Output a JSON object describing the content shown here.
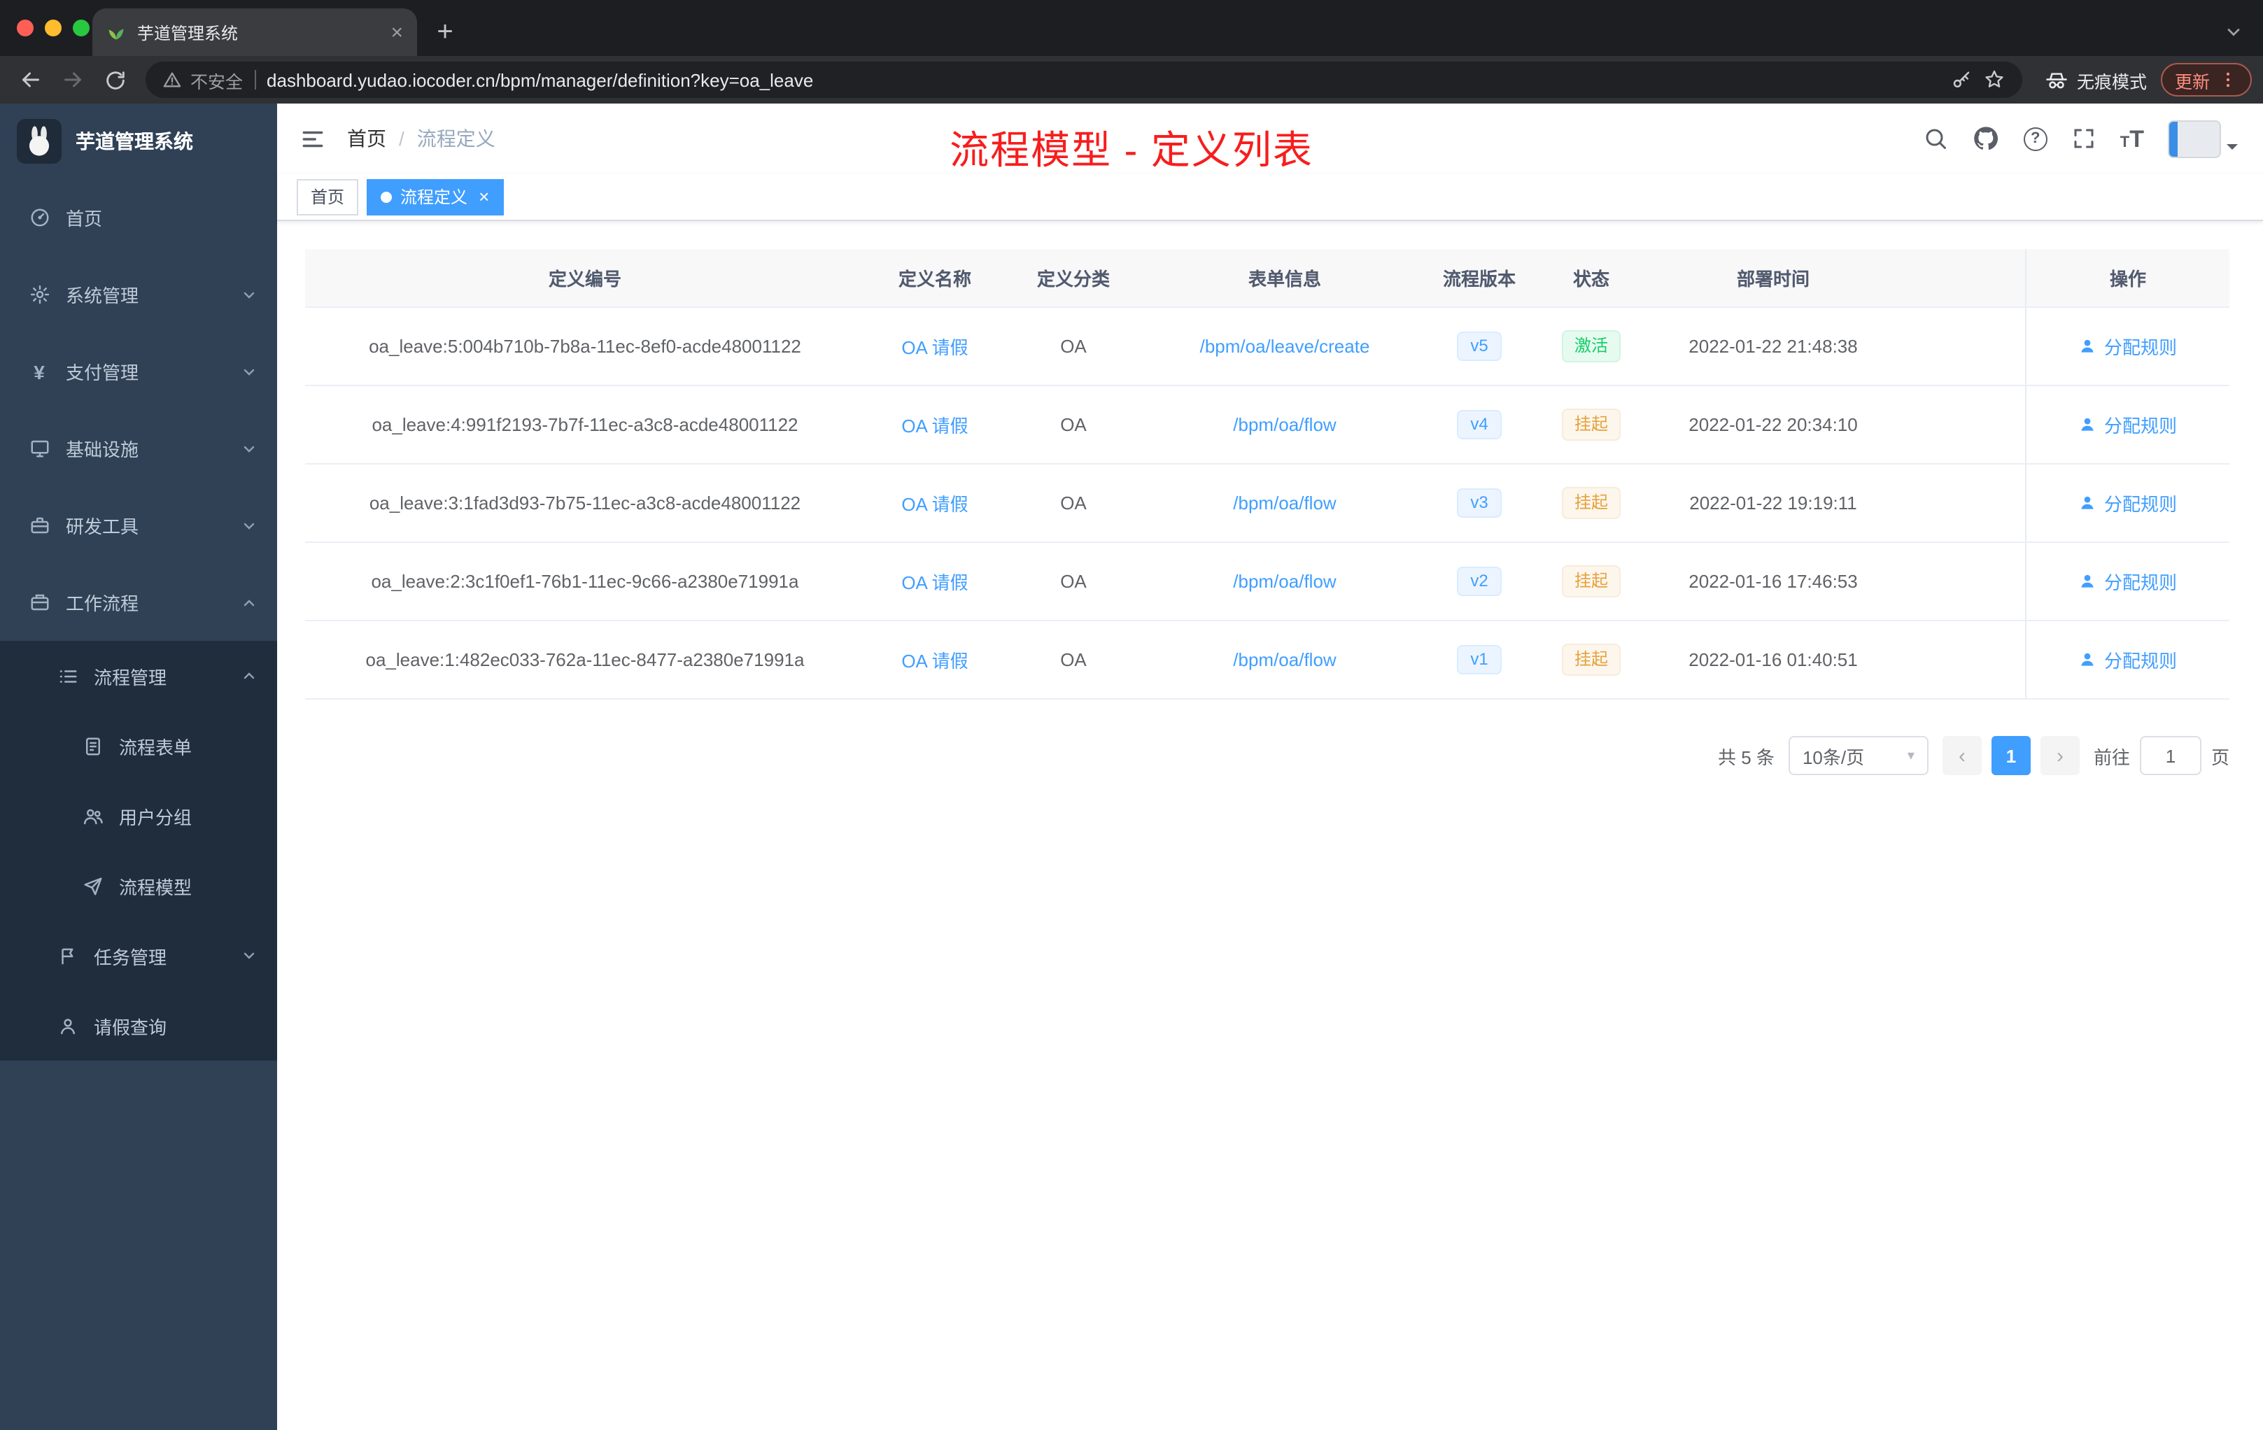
{
  "colors": {
    "accent": "#409eff",
    "link": "#409eff",
    "success": "#13ce66",
    "warning": "#e6a23c",
    "annotation": "#f81d1d"
  },
  "icons": {
    "tab_close": "×",
    "new_tab_plus": "+",
    "tag_close": "×",
    "help_mark": "?",
    "font_size_small": "T",
    "font_size_large": "T",
    "yen": "¥",
    "page_prev": "‹",
    "page_next": "›",
    "select_caret": "▾"
  },
  "browser": {
    "tab_title": "芋道管理系统",
    "security_label": "不安全",
    "url": "dashboard.yudao.iocoder.cn/bpm/manager/definition?key=oa_leave",
    "incognito_label": "无痕模式",
    "update_label": "更新"
  },
  "sidebar": {
    "logo_title": "芋道管理系统",
    "items": [
      {
        "label": "首页"
      },
      {
        "label": "系统管理"
      },
      {
        "label": "支付管理"
      },
      {
        "label": "基础设施"
      },
      {
        "label": "研发工具"
      },
      {
        "label": "工作流程"
      },
      {
        "label": "流程管理"
      },
      {
        "label": "流程表单"
      },
      {
        "label": "用户分组"
      },
      {
        "label": "流程模型"
      },
      {
        "label": "任务管理"
      },
      {
        "label": "请假查询"
      }
    ]
  },
  "header": {
    "breadcrumb_home": "首页",
    "breadcrumb_sep": "/",
    "breadcrumb_current": "流程定义",
    "annotation": "流程模型 - 定义列表"
  },
  "tags": {
    "home": "首页",
    "active": "流程定义"
  },
  "table": {
    "columns": {
      "id": "定义编号",
      "name": "定义名称",
      "category": "定义分类",
      "form": "表单信息",
      "version": "流程版本",
      "status": "状态",
      "deploy_time": "部署时间",
      "action": "操作"
    },
    "rows": [
      {
        "id": "oa_leave:5:004b710b-7b8a-11ec-8ef0-acde48001122",
        "name": "OA 请假",
        "category": "OA",
        "form": "/bpm/oa/leave/create",
        "version": "v5",
        "status": "激活",
        "deploy_time": "2022-01-22 21:48:38",
        "action": "分配规则"
      },
      {
        "id": "oa_leave:4:991f2193-7b7f-11ec-a3c8-acde48001122",
        "name": "OA 请假",
        "category": "OA",
        "form": "/bpm/oa/flow",
        "version": "v4",
        "status": "挂起",
        "deploy_time": "2022-01-22 20:34:10",
        "action": "分配规则"
      },
      {
        "id": "oa_leave:3:1fad3d93-7b75-11ec-a3c8-acde48001122",
        "name": "OA 请假",
        "category": "OA",
        "form": "/bpm/oa/flow",
        "version": "v3",
        "status": "挂起",
        "deploy_time": "2022-01-22 19:19:11",
        "action": "分配规则"
      },
      {
        "id": "oa_leave:2:3c1f0ef1-76b1-11ec-9c66-a2380e71991a",
        "name": "OA 请假",
        "category": "OA",
        "form": "/bpm/oa/flow",
        "version": "v2",
        "status": "挂起",
        "deploy_time": "2022-01-16 17:46:53",
        "action": "分配规则"
      },
      {
        "id": "oa_leave:1:482ec033-762a-11ec-8477-a2380e71991a",
        "name": "OA 请假",
        "category": "OA",
        "form": "/bpm/oa/flow",
        "version": "v1",
        "status": "挂起",
        "deploy_time": "2022-01-16 01:40:51",
        "action": "分配规则"
      }
    ]
  },
  "pagination": {
    "total": "共 5 条",
    "page_size": "10条/页",
    "page": "1",
    "goto_label": "前往",
    "page_unit": "页",
    "goto_value": "1"
  }
}
